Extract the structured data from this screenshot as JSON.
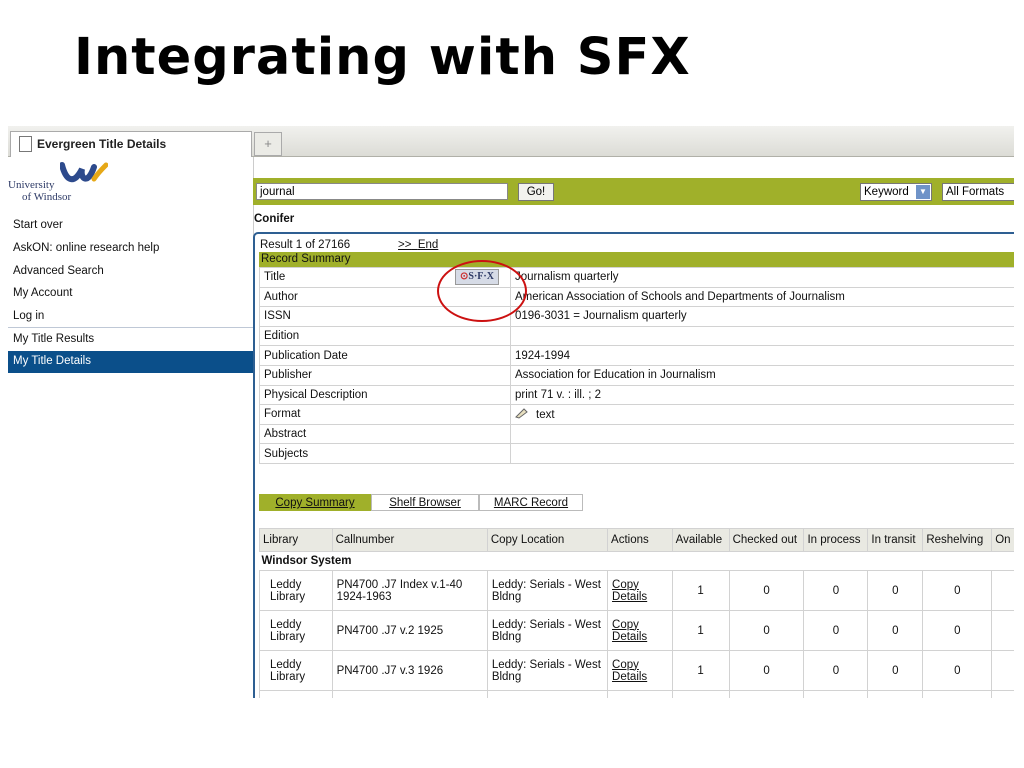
{
  "slide": {
    "title": "Integrating with SFX"
  },
  "browser": {
    "tab_title": "Evergreen Title Details",
    "new_tab": "+"
  },
  "logo": {
    "line1": "University",
    "line2": "of Windsor"
  },
  "sidebar": {
    "items": [
      {
        "label": "Start over"
      },
      {
        "label": "AskON: online research help"
      },
      {
        "label": "Advanced Search"
      },
      {
        "label": "My Account"
      },
      {
        "label": "Log in"
      },
      {
        "label": "My Title Results"
      },
      {
        "label": "My Title Details"
      }
    ]
  },
  "search": {
    "value": "journal",
    "go_label": "Go!",
    "type_select": "Keyword",
    "format_select": "All Formats"
  },
  "catalog_name": "Conifer",
  "results": {
    "position": "Result 1 of 27166",
    "next": ">>",
    "end": "End"
  },
  "record": {
    "summary_label": "Record Summary",
    "sfx_label": "S·F·X",
    "rows": [
      {
        "label": "Title",
        "value": "Journalism quarterly"
      },
      {
        "label": "Author",
        "value": "American Association of Schools and Departments of Journalism"
      },
      {
        "label": "ISSN",
        "value": "0196-3031 = Journalism quarterly"
      },
      {
        "label": "Edition",
        "value": ""
      },
      {
        "label": "Publication Date",
        "value": "1924-1994"
      },
      {
        "label": "Publisher",
        "value": "Association for Education in Journalism"
      },
      {
        "label": "Physical Description",
        "value": "print 71 v. : ill. ; 2"
      },
      {
        "label": "Format",
        "value": "text",
        "icon": "pencil-icon"
      },
      {
        "label": "Abstract",
        "value": ""
      },
      {
        "label": "Subjects",
        "value": ""
      }
    ]
  },
  "detail_tabs": [
    {
      "label": "Copy Summary",
      "active": true
    },
    {
      "label": "Shelf Browser",
      "active": false
    },
    {
      "label": "MARC Record",
      "active": false
    }
  ],
  "copies": {
    "headers": [
      "Library",
      "Callnumber",
      "Copy Location",
      "Actions",
      "Available",
      "Checked out",
      "In process",
      "In transit",
      "Reshelving",
      "On"
    ],
    "system": "Windsor System",
    "rows": [
      {
        "library": "Leddy Library",
        "callnumber": "PN4700 .J7 Index v.1-40 1924-1963",
        "location": "Leddy: Serials - West Bldng",
        "action": "Copy Details",
        "available": "1",
        "checked_out": "0",
        "in_process": "0",
        "in_transit": "0",
        "reshelving": "0"
      },
      {
        "library": "Leddy Library",
        "callnumber": "PN4700 .J7 v.2 1925",
        "location": "Leddy: Serials - West Bldng",
        "action": "Copy Details",
        "available": "1",
        "checked_out": "0",
        "in_process": "0",
        "in_transit": "0",
        "reshelving": "0"
      },
      {
        "library": "Leddy Library",
        "callnumber": "PN4700 .J7 v.3 1926",
        "location": "Leddy: Serials - West Bldng",
        "action": "Copy Details",
        "available": "1",
        "checked_out": "0",
        "in_process": "0",
        "in_transit": "0",
        "reshelving": "0"
      }
    ]
  },
  "colors": {
    "accent_green": "#a0b02a",
    "nav_blue": "#0b4f8a",
    "panel_border": "#2e5f92",
    "highlight_red": "#cc1111"
  }
}
